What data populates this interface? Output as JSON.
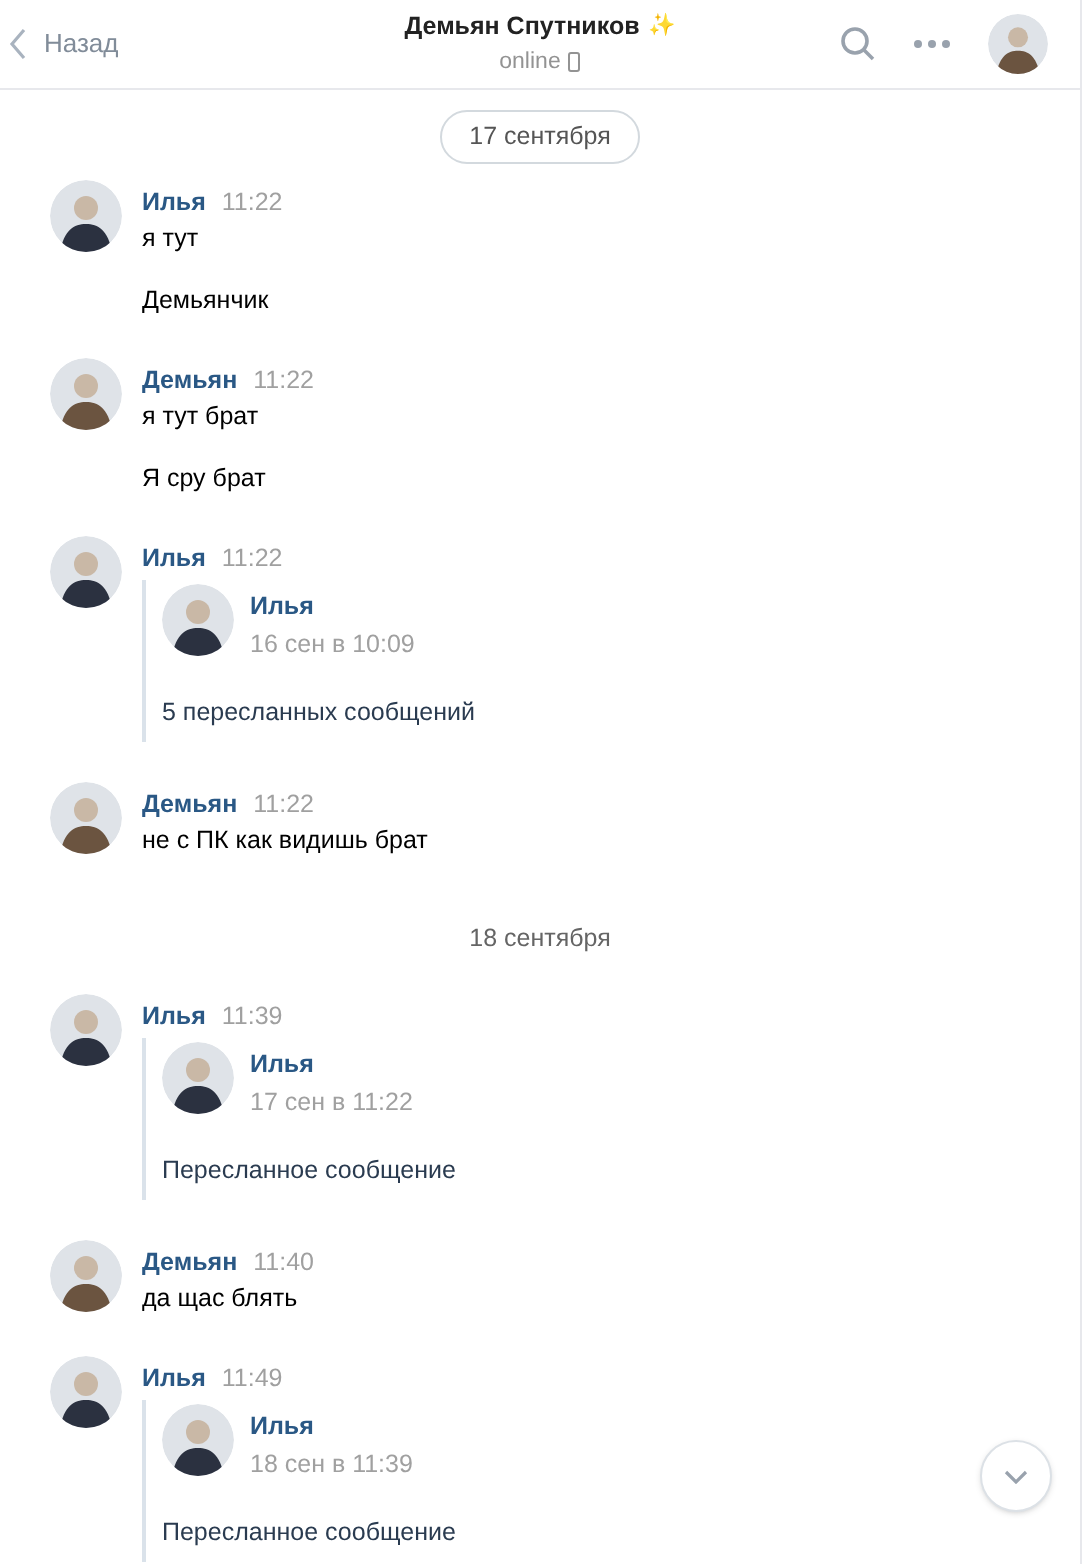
{
  "header": {
    "back": "Назад",
    "title": "Демьян Спутников",
    "title_emoji": "✨",
    "status": "online"
  },
  "feed": [
    {
      "kind": "date_pill",
      "text": "17 сентября"
    },
    {
      "kind": "message",
      "author": "Илья",
      "time": "11:22",
      "color": "#2b3140",
      "lines": [
        "я тут",
        "Демьянчик"
      ]
    },
    {
      "kind": "message",
      "author": "Демьян",
      "time": "11:22",
      "color": "#6b5440",
      "lines": [
        "я тут брат",
        "Я сру брат"
      ]
    },
    {
      "kind": "message",
      "author": "Илья",
      "time": "11:22",
      "color": "#2b3140",
      "forwarded": {
        "author": "Илья",
        "date": "16 сен в 10:09",
        "color": "#2b3140",
        "text": "5 пересланных сообщений"
      }
    },
    {
      "kind": "message",
      "author": "Демьян",
      "time": "11:22",
      "color": "#6b5440",
      "lines": [
        "не с ПК как видишь брат"
      ]
    },
    {
      "kind": "date_divider",
      "text": "18 сентября"
    },
    {
      "kind": "message",
      "author": "Илья",
      "time": "11:39",
      "color": "#2b3140",
      "forwarded": {
        "author": "Илья",
        "date": "17 сен в 11:22",
        "color": "#2b3140",
        "text": "Пересланное сообщение"
      }
    },
    {
      "kind": "message",
      "author": "Демьян",
      "time": "11:40",
      "color": "#6b5440",
      "lines": [
        "да щас блять"
      ]
    },
    {
      "kind": "message",
      "author": "Илья",
      "time": "11:49",
      "color": "#2b3140",
      "forwarded": {
        "author": "Илья",
        "date": "18 сен в 11:39",
        "color": "#2b3140",
        "text": "Пересланное сообщение"
      }
    }
  ]
}
